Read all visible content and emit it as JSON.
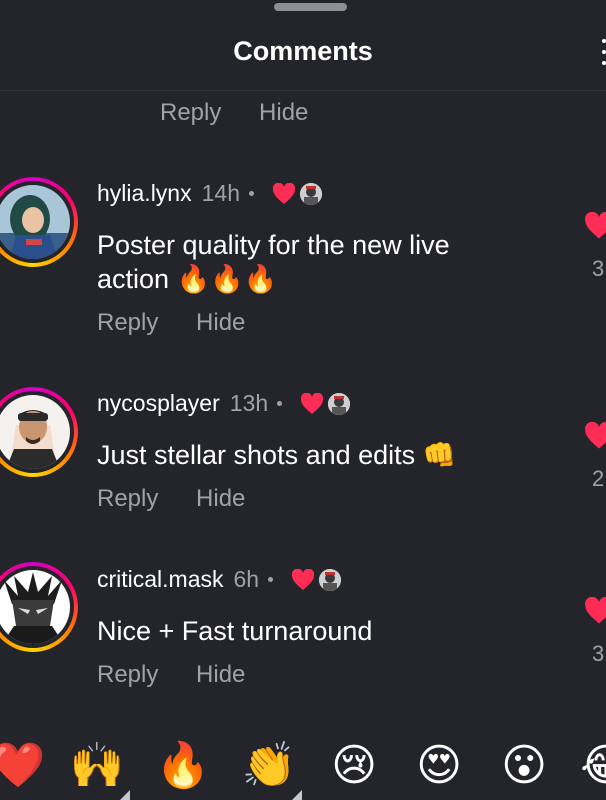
{
  "header": {
    "title": "Comments"
  },
  "top_actions": {
    "reply": "Reply",
    "hide": "Hide"
  },
  "comments": [
    {
      "username": "hylia.lynx",
      "time": "14h",
      "text": "Poster quality for the new live action",
      "emoji": "🔥🔥🔥",
      "reply": "Reply",
      "hide": "Hide",
      "likes": "3"
    },
    {
      "username": "nycosplayer",
      "time": "13h",
      "text": "Just stellar shots and edits",
      "emoji": "👊",
      "reply": "Reply",
      "hide": "Hide",
      "likes": "2"
    },
    {
      "username": "critical.mask",
      "time": "6h",
      "text": "Nice + Fast turnaround",
      "emoji": "",
      "reply": "Reply",
      "hide": "Hide",
      "likes": "3"
    }
  ],
  "reaction_bar": {
    "emojis": [
      "❤️",
      "🙌",
      "🔥",
      "👏",
      "😢",
      "😍",
      "😮",
      "😂"
    ]
  },
  "colors": {
    "background": "#24252a",
    "text": "#ffffff",
    "secondary_text": "#a0a2a8",
    "like_red": "#ff2d55"
  }
}
